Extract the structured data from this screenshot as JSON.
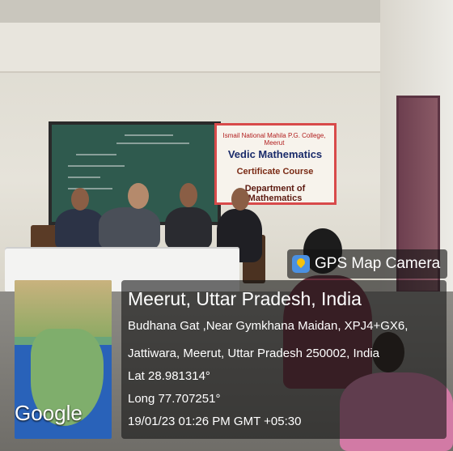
{
  "banner": {
    "college": "Ismail National Mahila P.G. College, Meerut",
    "title": "Vedic Mathematics",
    "subtitle": "Certificate Course",
    "department": "Department of Mathematics"
  },
  "gps_tag": "GPS Map Camera",
  "map": {
    "brand": "Google"
  },
  "location": {
    "city": "Meerut, Uttar Pradesh, India",
    "address_line1": "Budhana Gat ,Near Gymkhana Maidan, XPJ4+GX6,",
    "address_line2": "Jattiwara, Meerut, Uttar Pradesh 250002, India",
    "lat": "Lat 28.981314°",
    "long": "Long 77.707251°",
    "timestamp": "19/01/23 01:26 PM GMT +05:30"
  },
  "colors": {
    "banner_border": "#d84a4a",
    "overlay": "#141414",
    "map_sea": "#2962b9"
  }
}
